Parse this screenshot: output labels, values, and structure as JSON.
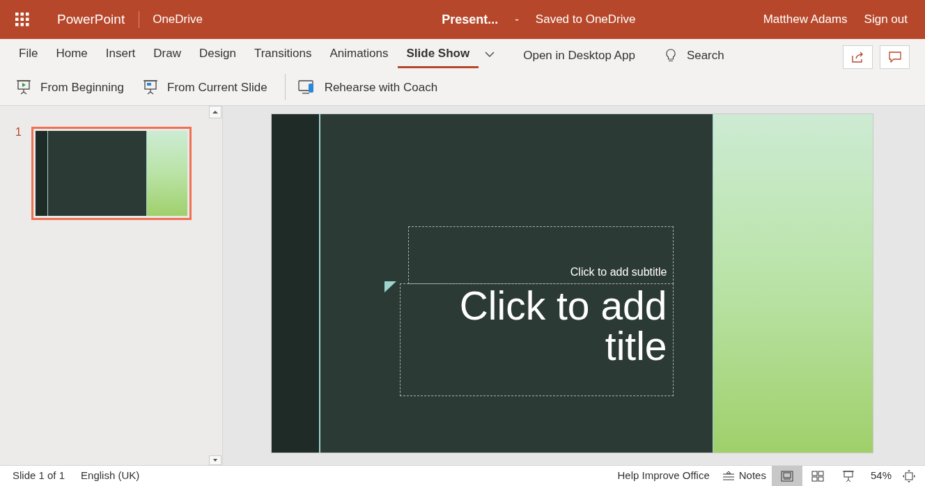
{
  "header": {
    "app_name": "PowerPoint",
    "location": "OneDrive",
    "document_title": "Present...",
    "separator": "-",
    "save_status": "Saved to OneDrive",
    "user_name": "Matthew Adams",
    "sign_out": "Sign out"
  },
  "tabs": [
    {
      "label": "File",
      "selected": false
    },
    {
      "label": "Home",
      "selected": false
    },
    {
      "label": "Insert",
      "selected": false
    },
    {
      "label": "Draw",
      "selected": false
    },
    {
      "label": "Design",
      "selected": false
    },
    {
      "label": "Transitions",
      "selected": false
    },
    {
      "label": "Animations",
      "selected": false
    },
    {
      "label": "Slide Show",
      "selected": true
    }
  ],
  "ribbon_actions": {
    "open_desktop": "Open in Desktop App",
    "search": "Search"
  },
  "commands": [
    {
      "label": "From Beginning",
      "kind": "beginning"
    },
    {
      "label": "From Current Slide",
      "kind": "current"
    },
    {
      "label": "Rehearse with Coach",
      "kind": "coach"
    }
  ],
  "thumbnails": [
    {
      "number": "1",
      "selected": true
    }
  ],
  "slide": {
    "subtitle_placeholder": "Click to add subtitle",
    "title_placeholder": "Click to add title"
  },
  "status_bar": {
    "slide_count": "Slide 1 of 1",
    "language": "English (UK)",
    "help": "Help Improve Office",
    "notes": "Notes",
    "views": [
      {
        "kind": "normal",
        "selected": true
      },
      {
        "kind": "sorter",
        "selected": false
      },
      {
        "kind": "reading",
        "selected": false
      }
    ],
    "zoom": "54%"
  }
}
